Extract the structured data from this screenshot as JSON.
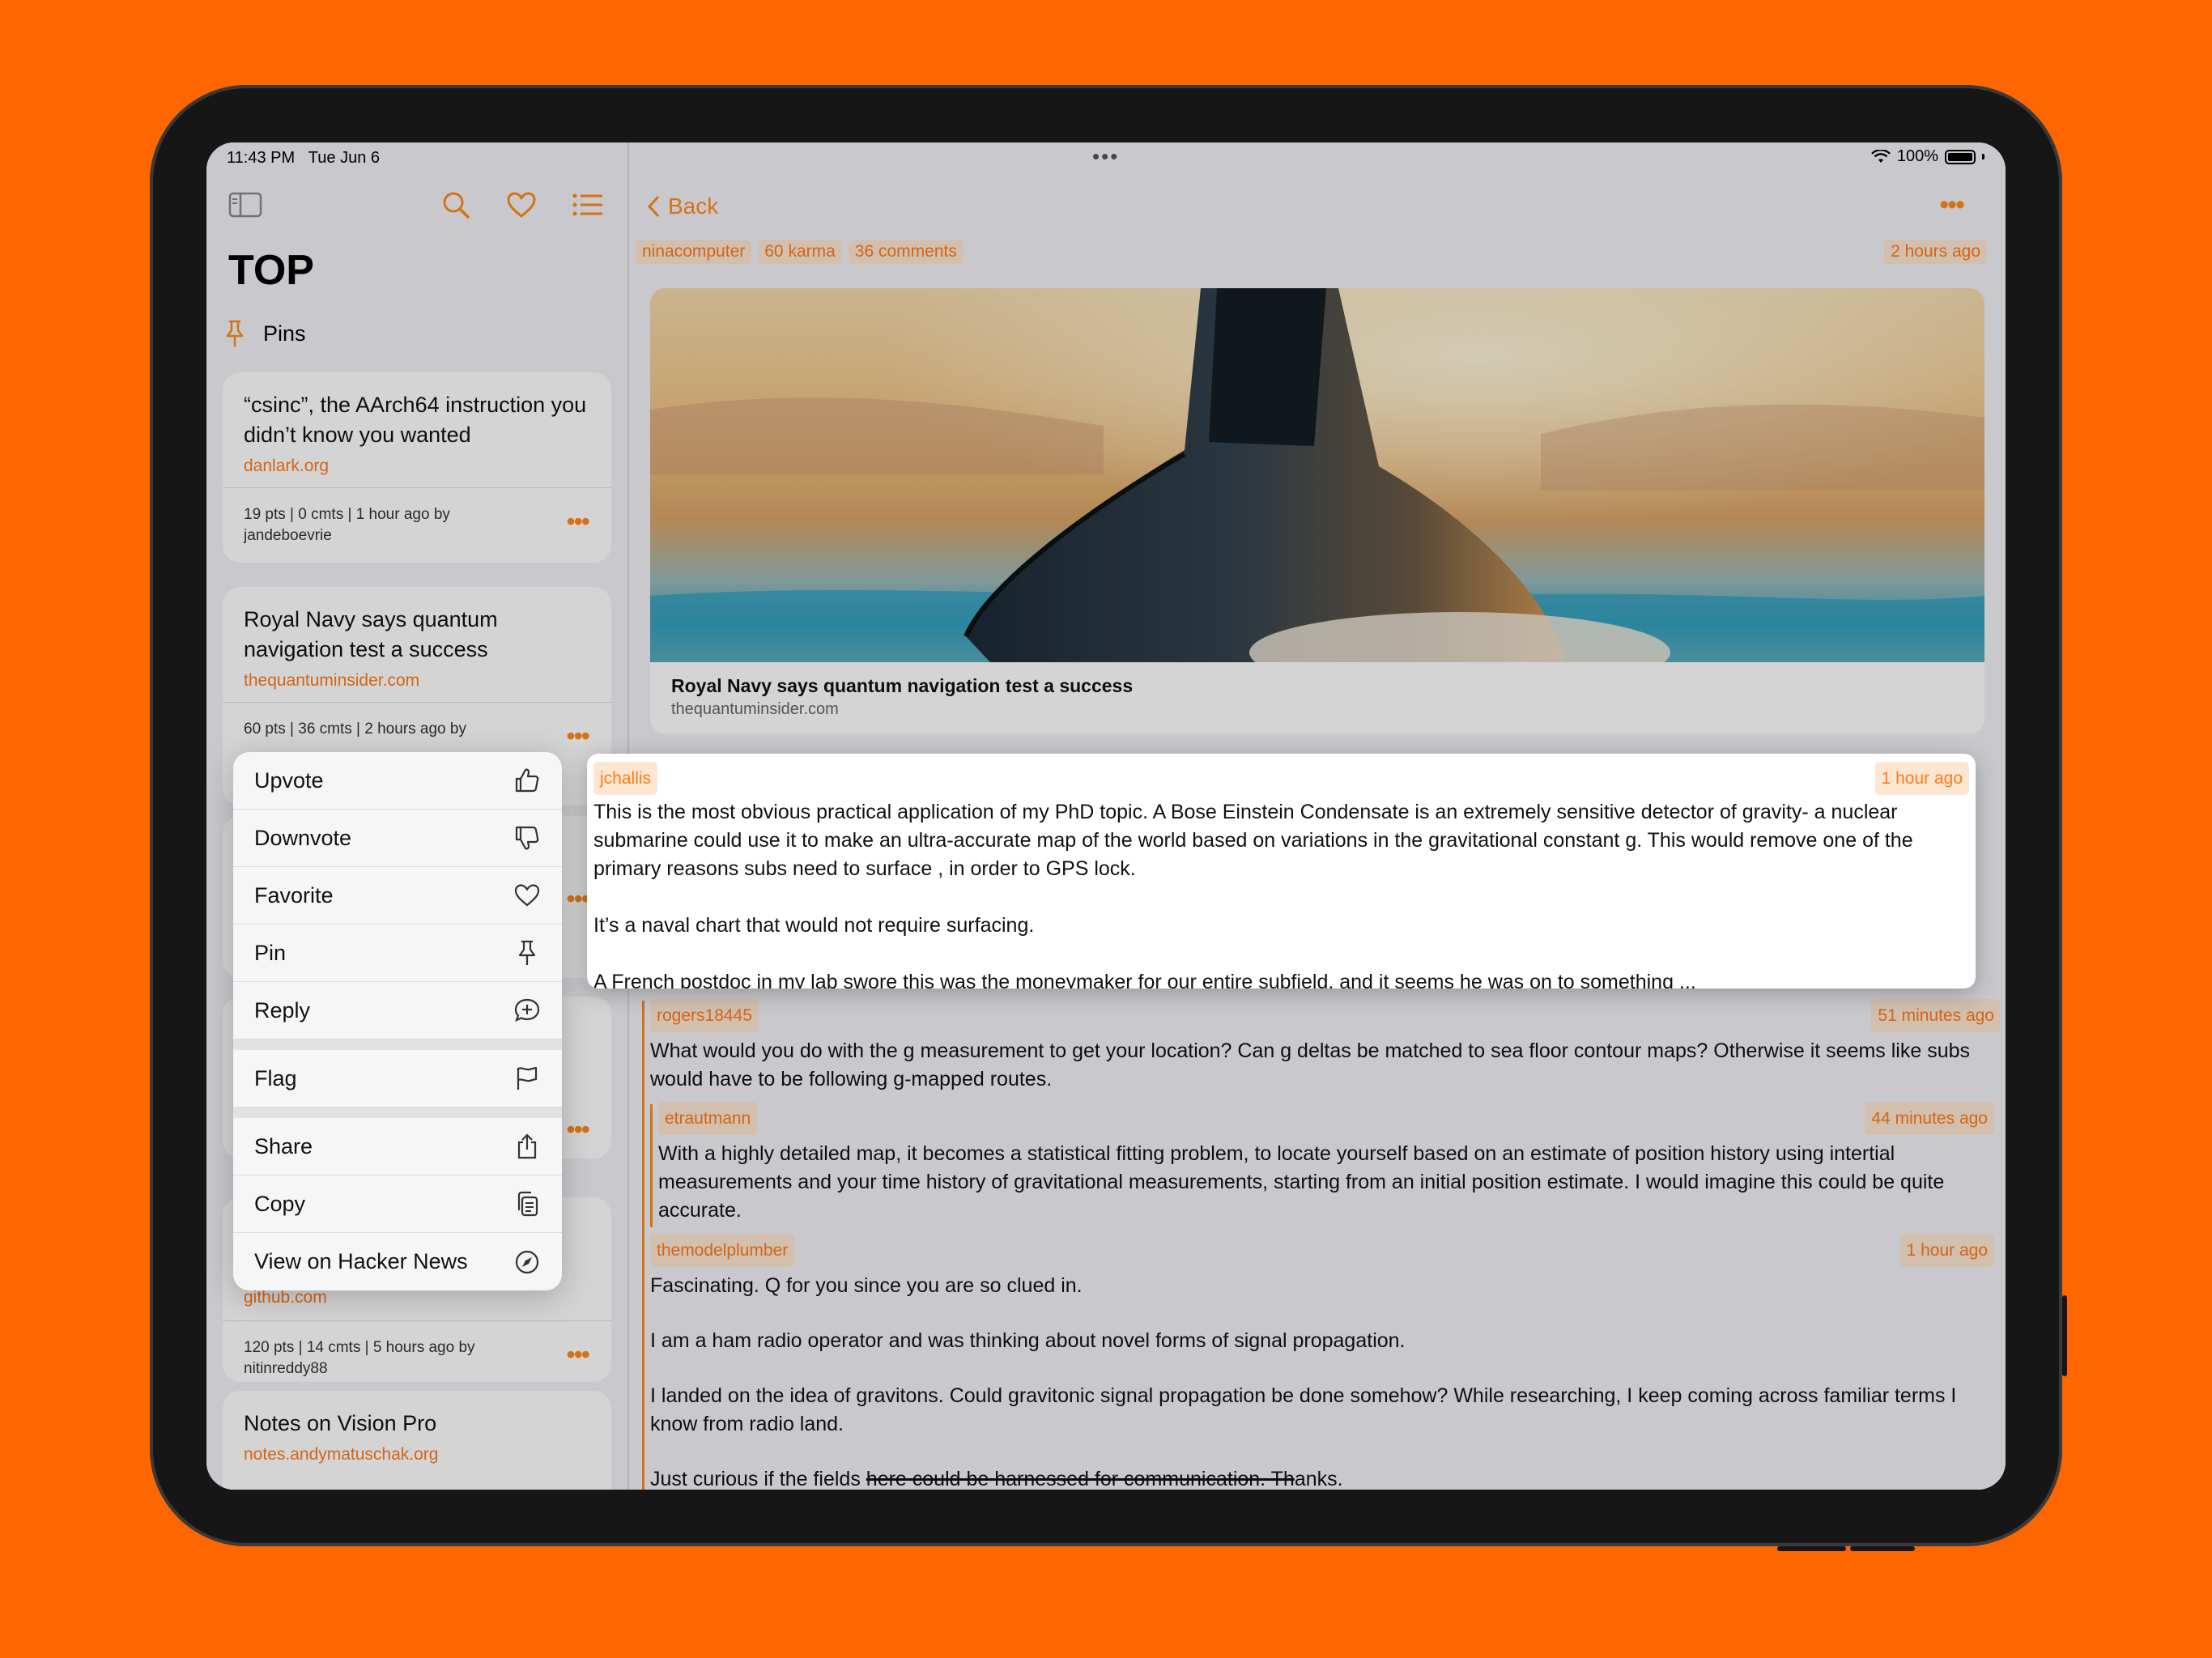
{
  "status_bar": {
    "time": "11:43 PM",
    "date": "Tue Jun 6",
    "battery": "100%"
  },
  "sidebar": {
    "title": "TOP",
    "pins_label": "Pins",
    "cards": [
      {
        "title": "“csinc”, the AArch64 instruction you didn’t know you wanted",
        "domain": "danlark.org",
        "meta": "19 pts | 0 cmts | 1 hour ago by jandeboevrie"
      },
      {
        "title": "Royal Navy says quantum navigation test a success",
        "domain": "thequantuminsider.com",
        "meta": "60 pts | 36 cmts | 2 hours ago by"
      },
      {
        "domain": "github.com",
        "meta": "120 pts | 14 cmts | 5 hours ago by nitinreddy88"
      },
      {
        "title": "Notes on Vision Pro",
        "domain": "notes.andymatuschak.org"
      }
    ]
  },
  "context_menu": {
    "items": [
      {
        "label": "Upvote",
        "icon": "thumbs-up-icon"
      },
      {
        "label": "Downvote",
        "icon": "thumbs-down-icon"
      },
      {
        "label": "Favorite",
        "icon": "heart-icon"
      },
      {
        "label": "Pin",
        "icon": "pin-icon"
      },
      {
        "label": "Reply",
        "icon": "reply-bubble-icon"
      },
      {
        "label": "Flag",
        "icon": "flag-icon"
      },
      {
        "label": "Share",
        "icon": "share-icon"
      },
      {
        "label": "Copy",
        "icon": "copy-icon"
      },
      {
        "label": "View on Hacker News",
        "icon": "compass-icon"
      }
    ]
  },
  "detail": {
    "back_label": "Back",
    "author": "ninacomputer",
    "karma": "60 karma",
    "comments_count": "36 comments",
    "posted": "2 hours ago",
    "story": {
      "title": "Royal Navy says quantum navigation test a success",
      "domain": "thequantuminsider.com"
    },
    "focused_comment": {
      "user": "jchallis",
      "time": "1 hour ago",
      "paragraphs": [
        "This is the most obvious practical application of my PhD topic. A Bose Einstein Condensate is an extremely sensitive detector of gravity- a nuclear submarine could use it to make an ultra-accurate map of the world based on variations in the gravitational constant g. This would remove one of the primary reasons subs need to surface , in order to GPS lock.",
        "It’s a naval chart that would not require surfacing.",
        "A French postdoc in my lab swore this was the moneymaker for our entire subfield, and it seems he was on to something ..."
      ]
    },
    "comments": [
      {
        "user": "rogers18445",
        "time": "51 minutes ago",
        "text": "What would you do with the g measurement to get your location? Can g deltas be matched to sea floor contour maps? Otherwise it seems like subs would have to be following g-mapped routes."
      },
      {
        "user": "etrautmann",
        "time": "44 minutes ago",
        "text": "With a highly detailed map, it becomes a statistical fitting problem, to locate yourself based on an estimate of position history using intertial measurements and your time history of gravitational measurements, starting from an initial position estimate. I would imagine this could be quite accurate."
      },
      {
        "user": "themodelplumber",
        "time": "1 hour ago",
        "p1": "Fascinating. Q for you since you are so clued in.",
        "p2": "I am a ham radio operator and was thinking about novel forms of signal propagation.",
        "p3": "I landed on the idea of gravitons. Could gravitonic signal propagation be done somehow? While researching, I keep coming across familiar terms I know from radio land.",
        "p4_a": "Just curious if the fields ",
        "p4_b": "here could be harnessed for communication. Th",
        "p4_c": "anks."
      }
    ]
  },
  "colors": {
    "accent": "#ff8a1a",
    "background": "#ff6600"
  }
}
